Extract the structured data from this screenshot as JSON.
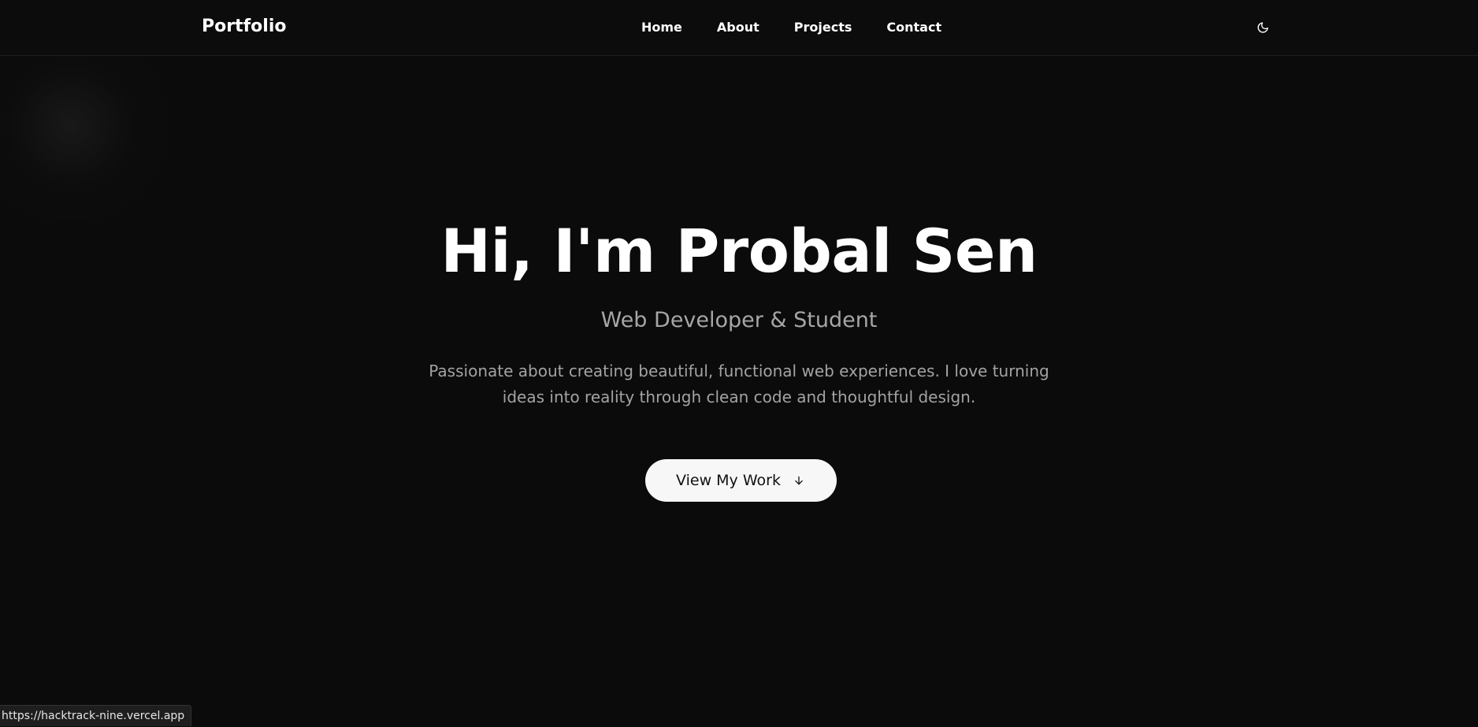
{
  "nav": {
    "brand": "Portfolio",
    "links": [
      {
        "label": "Home"
      },
      {
        "label": "About"
      },
      {
        "label": "Projects"
      },
      {
        "label": "Contact"
      }
    ],
    "theme_toggle_icon": "moon-icon"
  },
  "hero": {
    "title": "Hi, I'm Probal Sen",
    "subtitle": "Web Developer & Student",
    "description": "Passionate about creating beautiful, functional web experiences. I love turning ideas into reality through clean code and thoughtful design.",
    "cta_label": "View My Work",
    "cta_icon": "arrow-down-icon"
  },
  "status_bar": {
    "url": "https://hacktrack-nine.vercel.app"
  },
  "colors": {
    "background": "#0b0b0b",
    "text_primary": "#ffffff",
    "text_muted": "#a6a6a6",
    "button_bg": "#f7f7f7",
    "button_text": "#111111"
  }
}
